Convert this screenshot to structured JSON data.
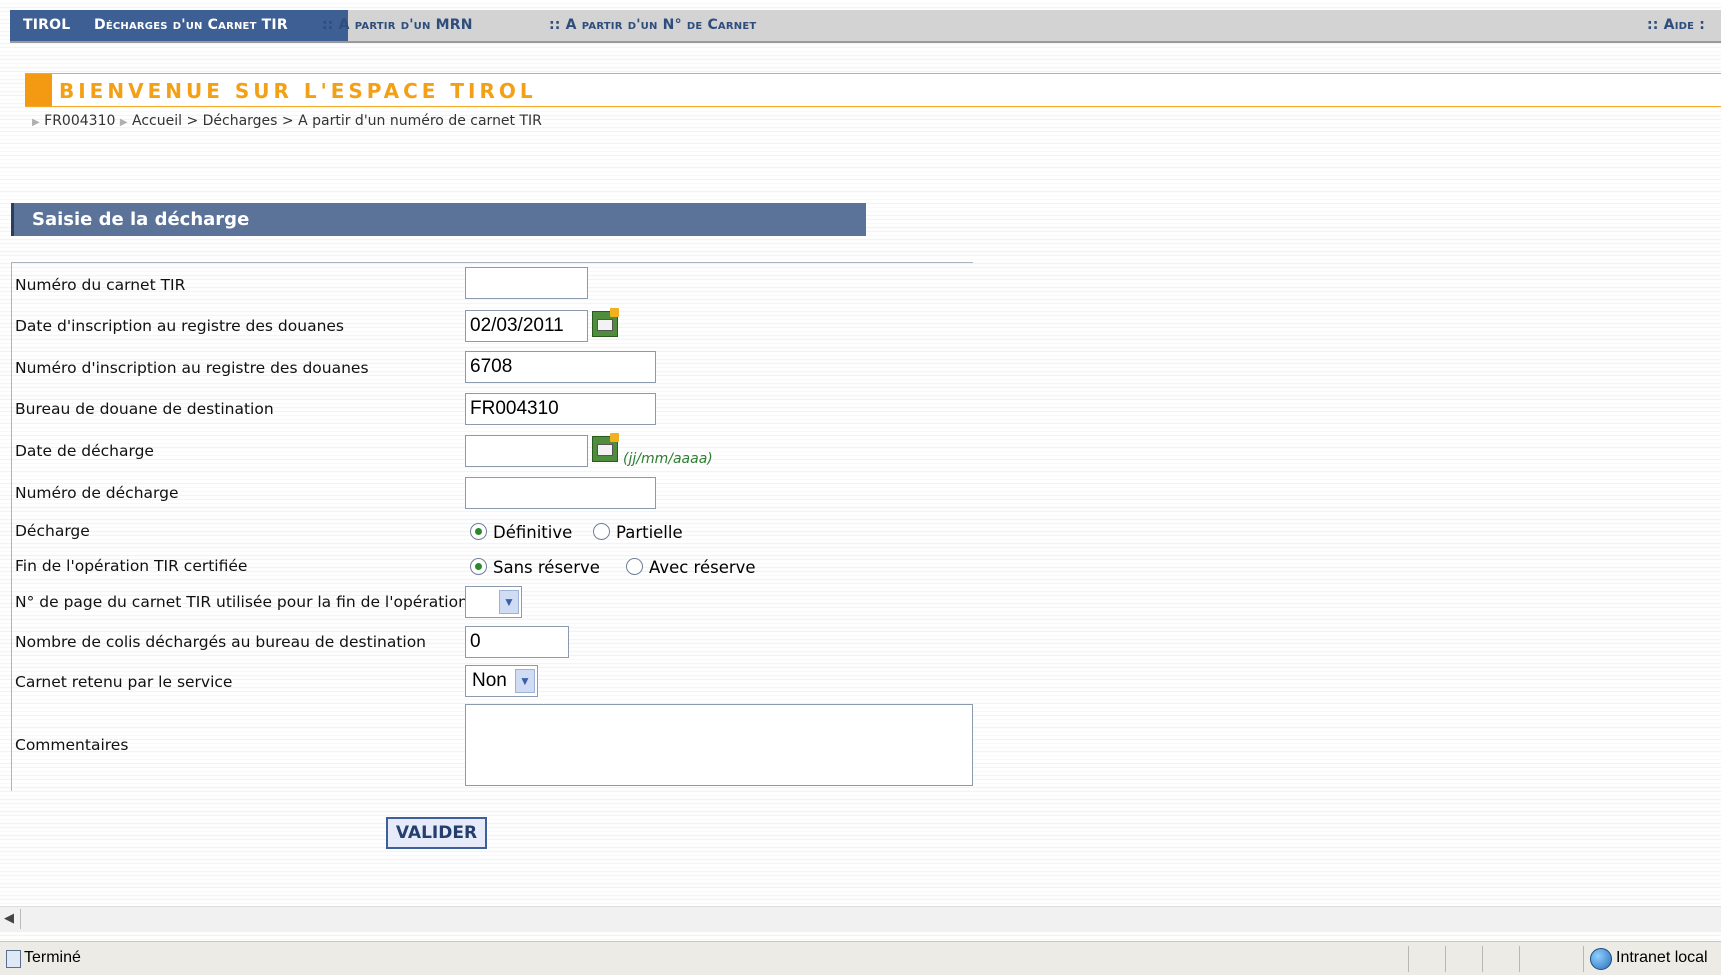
{
  "topbar": {
    "app": "TIROL",
    "current": "Décharges d'un Carnet TIR",
    "link_mrn": ":: A partir d'un MRN",
    "link_carnet": ":: A partir d'un N° de Carnet",
    "link_aide": ":: Aide :"
  },
  "header": {
    "welcome": "BIENVENUE SUR L'ESPACE TIROL",
    "breadcrumb_office": "FR004310",
    "breadcrumb_path": "Accueil > Décharges > A partir d'un numéro de carnet TIR"
  },
  "section": {
    "title": "Saisie de la décharge"
  },
  "form": {
    "carnet_label": "Numéro du carnet TIR",
    "carnet_value": "",
    "date_inscription_label": "Date d'inscription au registre des douanes",
    "date_inscription_value": "02/03/2011",
    "num_inscription_label": "Numéro d'inscription au registre des douanes",
    "num_inscription_value": "6708",
    "bureau_label": "Bureau de douane de destination",
    "bureau_value": "FR004310",
    "date_decharge_label": "Date de décharge",
    "date_decharge_value": "",
    "date_hint": "(jj/mm/aaaa)",
    "num_decharge_label": "Numéro de décharge",
    "num_decharge_value": "",
    "decharge_label": "Décharge",
    "decharge_opt1": "Définitive",
    "decharge_opt2": "Partielle",
    "fin_label": "Fin de l'opération TIR certifiée",
    "fin_opt1": "Sans réserve",
    "fin_opt2": "Avec réserve",
    "page_label": "N° de page du carnet TIR utilisée pour la fin de l'opération",
    "page_value": "",
    "colis_label": "Nombre de colis déchargés au bureau de destination",
    "colis_value": "0",
    "retenu_label": "Carnet retenu par le service",
    "retenu_value": "Non",
    "comment_label": "Commentaires",
    "comment_value": "",
    "submit": "VALIDER"
  },
  "statusbar": {
    "status": "Terminé",
    "zone": "Intranet local"
  },
  "icons": [
    "calendar-icon",
    "chevron-down-icon",
    "globe-icon",
    "page-icon"
  ]
}
